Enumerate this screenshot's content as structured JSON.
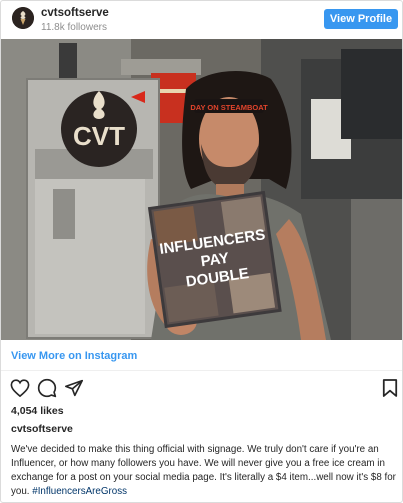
{
  "header": {
    "username": "cvtsoftserve",
    "followers": "11.8k followers",
    "view_profile_label": "View Profile"
  },
  "photo": {
    "logo_text": "CVT",
    "headband_text": "DAY ON STEAMBOAT",
    "poster_line1": "INFLUENCERS",
    "poster_line2": "PAY",
    "poster_line3": "DOUBLE"
  },
  "view_more_label": "View More on Instagram",
  "actions": {
    "like_icon": "heart-icon",
    "comment_icon": "comment-icon",
    "share_icon": "share-icon",
    "save_icon": "bookmark-icon"
  },
  "likes": "4,054 likes",
  "caption": {
    "username": "cvtsoftserve",
    "text": "We've decided to make this thing official with signage. We truly don't care if you're an Influencer, or how many followers you have. We will never give you a free ice cream in exchange for a post on your social media page. It's literally a $4 item...well now it's $8 for you. ",
    "hashtag": "#InfluencersAreGross"
  },
  "colors": {
    "accent": "#3897f0",
    "hashtag": "#003569",
    "secondary_text": "#8e8e8e"
  }
}
